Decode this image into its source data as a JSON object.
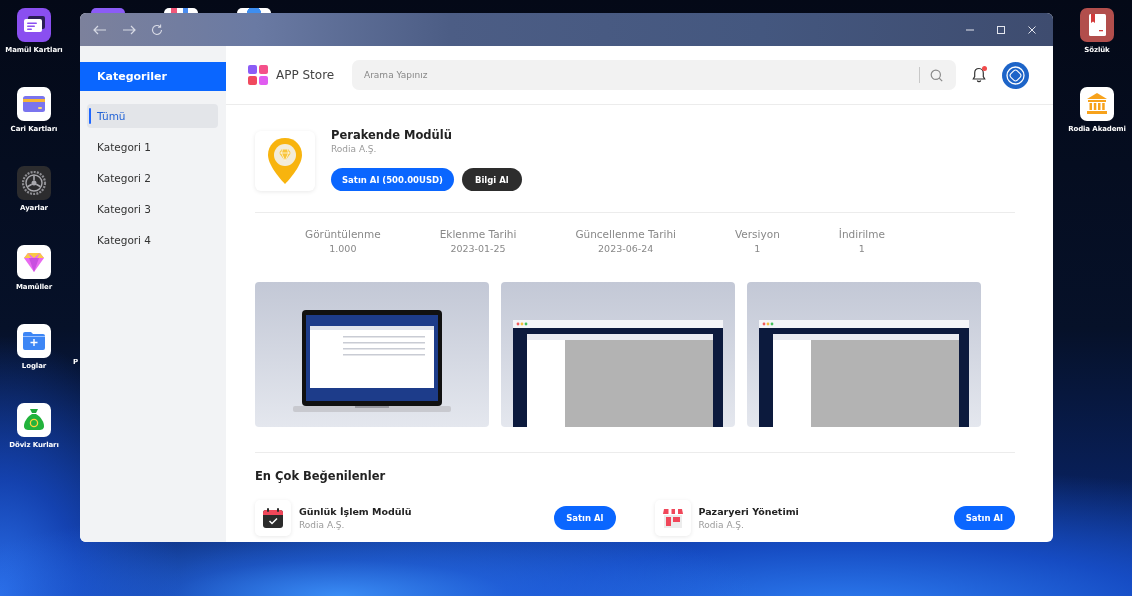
{
  "desktop": {
    "left_icons": [
      {
        "label": "Mamül Kartları",
        "kind": "cards"
      },
      {
        "label": "Cari Kartları",
        "kind": "credit-card"
      },
      {
        "label": "Ayarlar",
        "kind": "gear"
      },
      {
        "label": "Mamüller",
        "kind": "diamond"
      },
      {
        "label": "Loglar",
        "kind": "folder"
      },
      {
        "label": "Döviz Kurları",
        "kind": "money-bag"
      }
    ],
    "covered_label": "P",
    "right_icons": [
      {
        "label": "Sözlük",
        "kind": "book"
      },
      {
        "label": "Rodia Akademi",
        "kind": "bank"
      }
    ]
  },
  "sidebar": {
    "title": "Kategoriler",
    "items": [
      {
        "label": "Tümü",
        "selected": true
      },
      {
        "label": "Kategori 1",
        "selected": false
      },
      {
        "label": "Kategori 2",
        "selected": false
      },
      {
        "label": "Kategori 3",
        "selected": false
      },
      {
        "label": "Kategori 4",
        "selected": false
      }
    ]
  },
  "header": {
    "brand": "APP Store",
    "search": {
      "placeholder": "Arama Yapınız"
    },
    "notifications": {
      "unread": true
    }
  },
  "app": {
    "name": "Perakende Modülü",
    "publisher": "Rodia A.Ş.",
    "buttons": [
      {
        "label": "Satın Al (500.00USD)",
        "kind": "primary"
      },
      {
        "label": "Bilgi Al",
        "kind": "secondary"
      }
    ],
    "stats": [
      {
        "label": "Görüntülenme",
        "value": "1.000"
      },
      {
        "label": "Eklenme Tarihi",
        "value": "2023-01-25"
      },
      {
        "label": "Güncellenme Tarihi",
        "value": "2023-06-24"
      },
      {
        "label": "Versiyon",
        "value": "1"
      },
      {
        "label": "İndirilme",
        "value": "1"
      }
    ],
    "screenshots": [
      {
        "kind": "laptop"
      },
      {
        "kind": "browser"
      },
      {
        "kind": "browser"
      }
    ]
  },
  "most_liked": {
    "title": "En Çok Beğenilenler",
    "items": [
      {
        "name": "Günlük İşlem Modülü",
        "publisher": "Rodia A.Ş.",
        "kind": "calendar",
        "button": "Satın Al"
      },
      {
        "name": "Pazaryeri Yönetimi",
        "publisher": "Rodia A.Ş.",
        "kind": "store",
        "button": "Satın Al"
      }
    ]
  }
}
